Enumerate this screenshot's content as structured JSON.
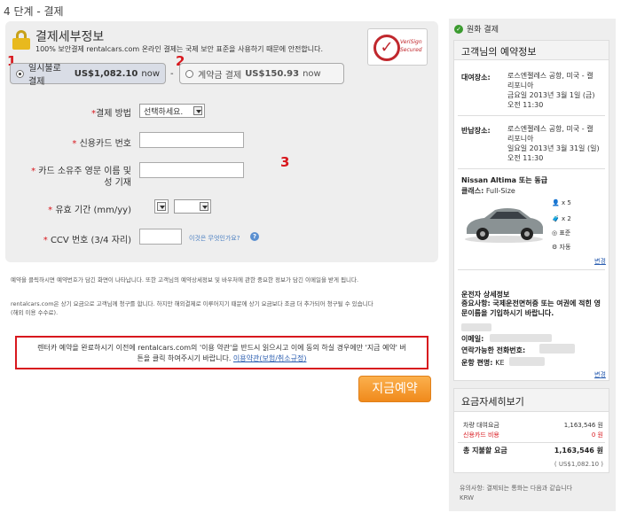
{
  "step_title": "4 단계 - 결제",
  "payment": {
    "title": "결제세부정보",
    "subtitle": "100% 보안결제 rentalcars.com 온라인 결제는 국제 보안 표준을 사용하기 때문에 안전합니다.",
    "verisign": "VeriSign Secured",
    "annotations": [
      "1",
      "2",
      "3"
    ],
    "option_full": {
      "label": "일시불로 결제",
      "amount": "US$1,082.10",
      "suffix": "now",
      "selected": true
    },
    "separator": "-",
    "option_deposit": {
      "label": "계약금 결제",
      "amount": "US$150.93",
      "suffix": "now",
      "selected": false
    },
    "fields": {
      "method_label": "결제 방법",
      "method_value": "선택하세요.",
      "card_label": "신용카드 번호",
      "name_label_1": "카드 소유주 영문 이름 및",
      "name_label_2": "성 기재",
      "expiry_label": "유효 기간",
      "expiry_hint": "(mm/yy)",
      "ccv_label": "CCV 번호 (3/4 자리)",
      "ccv_help": "이것은 무엇인가요?",
      "required_mark": "*"
    }
  },
  "notes": {
    "line1": "예약을 클릭하시면 예약번호가 담긴 화면이 나타납니다. 또한 고객님의 예약상세정보 및 바우처에 관한 중요한 정보가 담긴 이메일을 받게 됩니다.",
    "line2": "rentalcars.com은 상기 요금으로 고객님께 청구를 합니다. 하지만 해외결제로 이루어지기 때문에 상기 요금보다 조금 더 추가되어 청구될 수 있습니다",
    "line3": "(해외 이용 수수료)."
  },
  "terms": {
    "text_1": "렌터카 예약을 완료하시기 이전에 rentalcars.com의 '이용 약관'을 반드시 읽으시고 이에 동의 하실 경우에만 '지금 예약' 버",
    "text_2": "튼을 클릭 하여주시기 바랍니다.",
    "link": "이용약관(보험/취소규정)"
  },
  "book_button": "지금예약",
  "sidebar": {
    "rate_label": "원화 결제",
    "booking_title": "고객님의 예약정보",
    "pickup_label": "대여장소:",
    "pickup_lines": [
      "로스엔젤레스 공항, 미국 - 캘",
      "리포니아",
      "금요일 2013년 3월 1일 (금)",
      "오전 11:30"
    ],
    "dropoff_label": "반납장소:",
    "dropoff_lines": [
      "로스엔젤레스 공항, 미국 - 캘",
      "리포니아",
      "일요일 2013년 3월 31일 (일)",
      "오전 11:30"
    ],
    "car_name": "Nissan Altima 또는 동급",
    "car_class_label": "클래스:",
    "car_class": "Full-Size",
    "features": [
      "x 5",
      "x 2",
      "표준",
      "자동"
    ],
    "change_link": "변경",
    "driver_title": "운전자 상세정보",
    "driver_note": "중요사항: 국제운전면허증 또는 여권에 적힌 영문이름을 기입하시기 바랍니다.",
    "email_label": "이메일:",
    "phone_label": "연락가능한 전화번호:",
    "flight_label": "운항 편명:",
    "flight_value": "KE",
    "change_link_2": "변경",
    "price_title": "요금자세히보기",
    "rental_label": "차량 대여요금",
    "rental_value": "1,163,546 원",
    "card_fee_label": "신용카드 비용",
    "card_fee_value": "0 원",
    "total_label": "총 지불할 요금",
    "total_value": "1,163,546 원",
    "total_usd": "( US$1,082.10 )",
    "footer_note_1": "유의사항: 결제되는 통화는 다음과 같습니다",
    "footer_note_2": "KRW"
  },
  "colors": {
    "accent_red": "#d8181e",
    "button_orange": "#f08a1c",
    "link_blue": "#2a5db0"
  }
}
